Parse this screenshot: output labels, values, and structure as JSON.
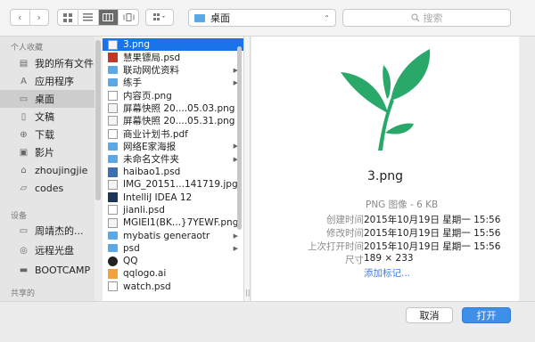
{
  "toolbar": {
    "back_icon": "chevron-left-icon",
    "forward_icon": "chevron-right-icon",
    "view_modes": [
      "icon-view",
      "list-view",
      "column-view",
      "cover-flow-view"
    ],
    "active_view": "column-view",
    "arrange_icon": "grid-arrange-icon",
    "location": "桌面",
    "search_placeholder": "搜索"
  },
  "sidebar": {
    "favorites_header": "个人收藏",
    "favorites": [
      {
        "label": "我的所有文件",
        "icon": "all-files-icon"
      },
      {
        "label": "应用程序",
        "icon": "applications-icon"
      },
      {
        "label": "桌面",
        "icon": "desktop-icon",
        "selected": true
      },
      {
        "label": "文稿",
        "icon": "documents-icon"
      },
      {
        "label": "下载",
        "icon": "downloads-icon"
      },
      {
        "label": "影片",
        "icon": "movies-icon"
      },
      {
        "label": "zhoujingjie",
        "icon": "home-icon"
      },
      {
        "label": "codes",
        "icon": "folder-icon"
      }
    ],
    "devices_header": "设备",
    "devices": [
      {
        "label": "周靖杰的...",
        "icon": "computer-icon"
      },
      {
        "label": "远程光盘",
        "icon": "remote-disc-icon"
      },
      {
        "label": "BOOTCAMP",
        "icon": "disk-icon"
      }
    ],
    "shared_header": "共享的"
  },
  "files": [
    {
      "name": "3.png",
      "type": "img",
      "selected": true
    },
    {
      "name": "慧果镖局.psd",
      "type": "app"
    },
    {
      "name": "联动网优资料",
      "type": "folder",
      "arrow": true
    },
    {
      "name": "练手",
      "type": "folder",
      "arrow": true
    },
    {
      "name": "内容页.png",
      "type": "doc"
    },
    {
      "name": "屏幕快照 20....05.03.png",
      "type": "img"
    },
    {
      "name": "屏幕快照 20....05.31.png",
      "type": "img"
    },
    {
      "name": "商业计划书.pdf",
      "type": "pdf"
    },
    {
      "name": "网络E家海报",
      "type": "folder",
      "arrow": true
    },
    {
      "name": "未命名文件夹",
      "type": "folder",
      "arrow": true
    },
    {
      "name": "haibao1.psd",
      "type": "ps"
    },
    {
      "name": "IMG_20151...141719.jpg",
      "type": "img"
    },
    {
      "name": "IntelliJ IDEA 12",
      "type": "idea"
    },
    {
      "name": "jianli.psd",
      "type": "doc"
    },
    {
      "name": "MGIEI1(BK...}7YEWF.png",
      "type": "img"
    },
    {
      "name": "mybatis generaotr",
      "type": "folder",
      "arrow": true
    },
    {
      "name": "psd",
      "type": "folder",
      "arrow": true
    },
    {
      "name": "QQ",
      "type": "qq"
    },
    {
      "name": "qqlogo.ai",
      "type": "ai"
    },
    {
      "name": "watch.psd",
      "type": "doc"
    }
  ],
  "preview": {
    "filename": "3.png",
    "kind": "PNG 图像 - 6 KB",
    "created_label": "创建时间",
    "created_value": "2015年10月19日 星期一 15:56",
    "modified_label": "修改时间",
    "modified_value": "2015年10月19日 星期一 15:56",
    "opened_label": "上次打开时间",
    "opened_value": "2015年10月19日 星期一 15:56",
    "dims_label": "尺寸",
    "dims_value": "189 × 233",
    "add_tags": "添加标记...",
    "leaf_color": "#2aa86a"
  },
  "buttons": {
    "cancel": "取消",
    "open": "打开"
  }
}
